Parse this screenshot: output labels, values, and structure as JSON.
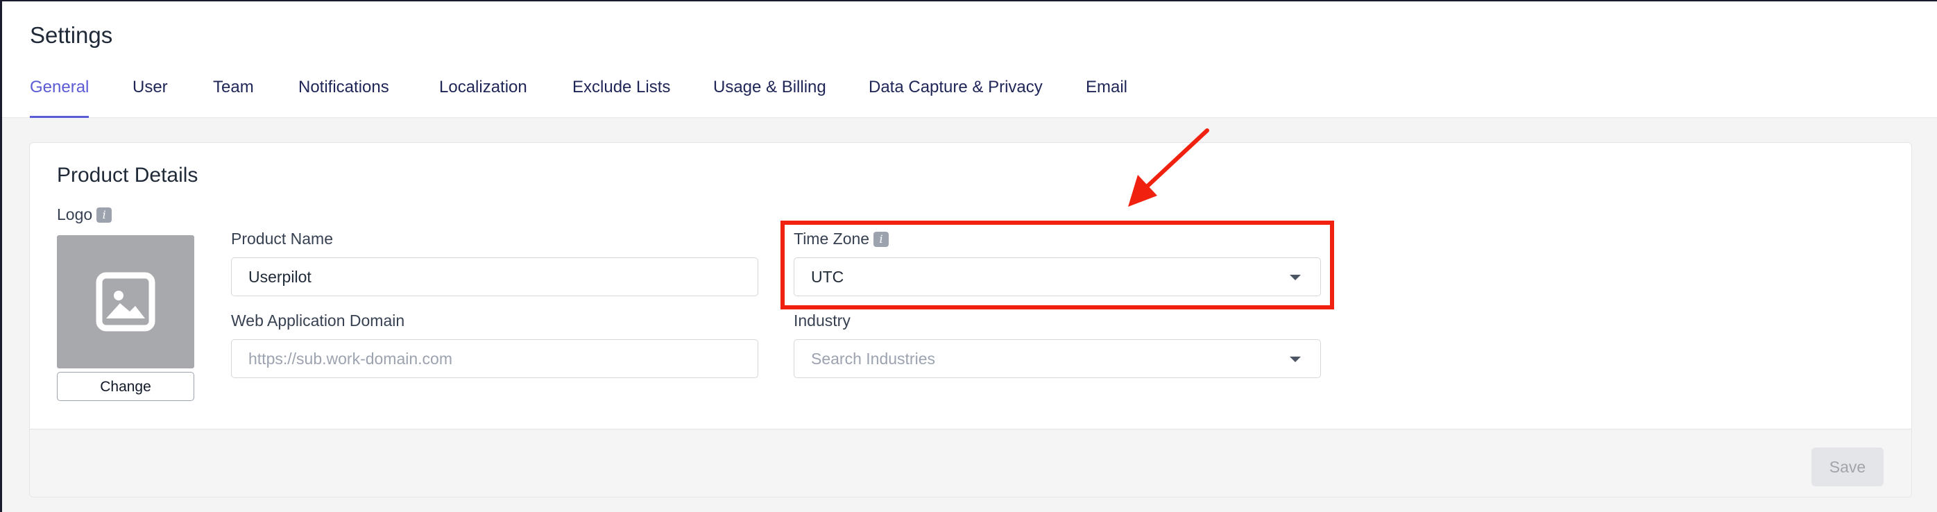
{
  "page": {
    "title": "Settings"
  },
  "tabs": [
    {
      "label": "General",
      "active": true
    },
    {
      "label": "User"
    },
    {
      "label": "Team"
    },
    {
      "label": "Notifications"
    },
    {
      "label": "Localization"
    },
    {
      "label": "Exclude Lists"
    },
    {
      "label": "Usage & Billing"
    },
    {
      "label": "Data Capture & Privacy"
    },
    {
      "label": "Email"
    }
  ],
  "product_details": {
    "title": "Product Details",
    "logo_label": "Logo",
    "change_label": "Change",
    "product_name_label": "Product Name",
    "product_name_value": "Userpilot",
    "web_domain_label": "Web Application Domain",
    "web_domain_placeholder": "https://sub.work-domain.com",
    "time_zone_label": "Time Zone",
    "time_zone_value": "UTC",
    "industry_label": "Industry",
    "industry_placeholder": "Search Industries"
  },
  "footer": {
    "save_label": "Save"
  },
  "icons": {
    "info": "info-icon",
    "image": "image-placeholder-icon",
    "dropdown": "chevron-down-icon"
  },
  "colors": {
    "accent": "#5b5bd6",
    "tab_text": "#1f2557",
    "annotation": "#f0220f"
  }
}
